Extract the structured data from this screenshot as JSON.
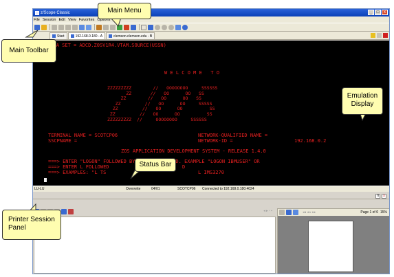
{
  "window": {
    "title": "z/Scope Classic"
  },
  "menu": [
    "File",
    "Session",
    "Edit",
    "View",
    "Favorites",
    "Options",
    "Help"
  ],
  "tabs": [
    {
      "label": "Start"
    },
    {
      "label": "192.168.0.180 - A"
    },
    {
      "label": "clemson.clemson.edu - B"
    }
  ],
  "screen": {
    "line1": "URCE DATA SET = ADCD.Z0SV1R4.VTAM.SOURCE(USSN)",
    "welcome": "W E L C O M E   T O",
    "ascii": "ZZZZZZZZZ        //   OOOOOOOO     SSSSSS\n       ZZ       //   OO      OO   SS\n     ZZ        //   OO      OO   SS\n   ZZ         //   OO      OO     SSSSS\n  ZZ         //   OO      OO          SS\n ZZ         //   OO      OO          SS\nZZZZZZZZZ  //     OOOOOOOO     SSSSSS",
    "terminal": "TERMINAL NAME = SCOTCP06",
    "network_q": "NETWORK-QUALIFIED NAME =",
    "sscp": "SSCPNAME =",
    "network_id": "NETWORK-ID =",
    "ip": "192.168.0.2",
    "system": "ZOS APPLICATION DEVELOPMENT SYSTEM - RELEASE 1.4.0",
    "logon1": "===> ENTER \"LOGON\" FOLLOWED BY THE TSO USERID. EXAMPLE \"LOGON IBMUSER\" OR",
    "logon2": "===> ENTER L FOLLOWED",
    "logon2_tail": "D",
    "examples": "===> EXAMPLES: \"L TS",
    "examples_tail": "L IMS3270"
  },
  "status": {
    "lu": "LU-LU",
    "mode": "Overwrite",
    "pos": "04/01",
    "terminal": "SCOTCP06",
    "connection": "Connected to 192.168.0.180:4024"
  },
  "printer": {
    "page_info": "Page 1 of 0",
    "zoom": "15%"
  },
  "callouts": {
    "main_menu": "Main Menu",
    "main_toolbar": "Main Toolbar",
    "emulation": "Emulation\nDisplay",
    "status_bar": "Status Bar",
    "printer_panel": "Printer Session\nPanel"
  },
  "colors": {
    "terminal_text": "#e82020",
    "terminal_bg": "#000000",
    "callout_bg": "#fffdb0"
  }
}
